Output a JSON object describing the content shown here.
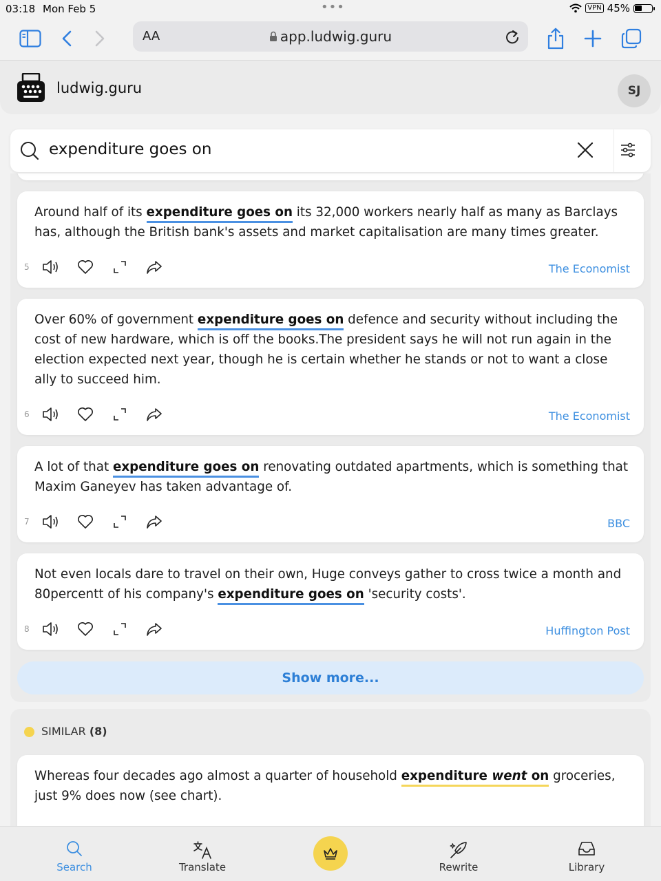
{
  "status": {
    "time": "03:18",
    "date": "Mon Feb 5",
    "vpn": "VPN",
    "battery": "45%"
  },
  "browser": {
    "text_size_label": "AA",
    "url": "app.ludwig.guru"
  },
  "app": {
    "brand": "ludwig.guru",
    "avatar_initials": "SJ"
  },
  "search": {
    "query": "expenditure goes on"
  },
  "results": [
    {
      "num": "5",
      "before": "Around half of its ",
      "highlight": "expenditure goes on",
      "after": " its 32,000 workers nearly half as many as Barclays has, although the British bank's assets and market capitalisation are many times greater.",
      "source": "The Economist"
    },
    {
      "num": "6",
      "before": "Over 60% of government ",
      "highlight": "expenditure goes on",
      "after": " defence and security without including the cost of new hardware, which is off the books.The president says he will not run again in the election expected next year, though he is certain whether he stands or not to want a close ally to succeed him.",
      "source": "The Economist"
    },
    {
      "num": "7",
      "before": "A lot of that ",
      "highlight": "expenditure goes on",
      "after": " renovating outdated apartments, which is something that Maxim Ganeyev has taken advantage of.",
      "source": "BBC"
    },
    {
      "num": "8",
      "before": "Not even locals dare to travel on their own, Huge conveys gather to cross twice a month and 80percentt of his company's ",
      "highlight": "expenditure goes on",
      "after": " 'security costs'.",
      "source": "Huffington Post"
    }
  ],
  "show_more": "Show more...",
  "similar": {
    "label": "SIMILAR",
    "count": "(8)",
    "first": {
      "before": "Whereas four decades ago almost a quarter of household ",
      "hl_word": "expenditure",
      "hl_italic": "went",
      "hl_end": "on",
      "after": " groceries, just 9% does now (see chart)."
    }
  },
  "nav": {
    "search": "Search",
    "translate": "Translate",
    "rewrite": "Rewrite",
    "library": "Library"
  },
  "colors": {
    "accent_blue": "#3d8fe0",
    "highlight_blue": "#4a90e2",
    "similar_yellow": "#f5d44f",
    "show_more_bg": "#dcebfb"
  }
}
